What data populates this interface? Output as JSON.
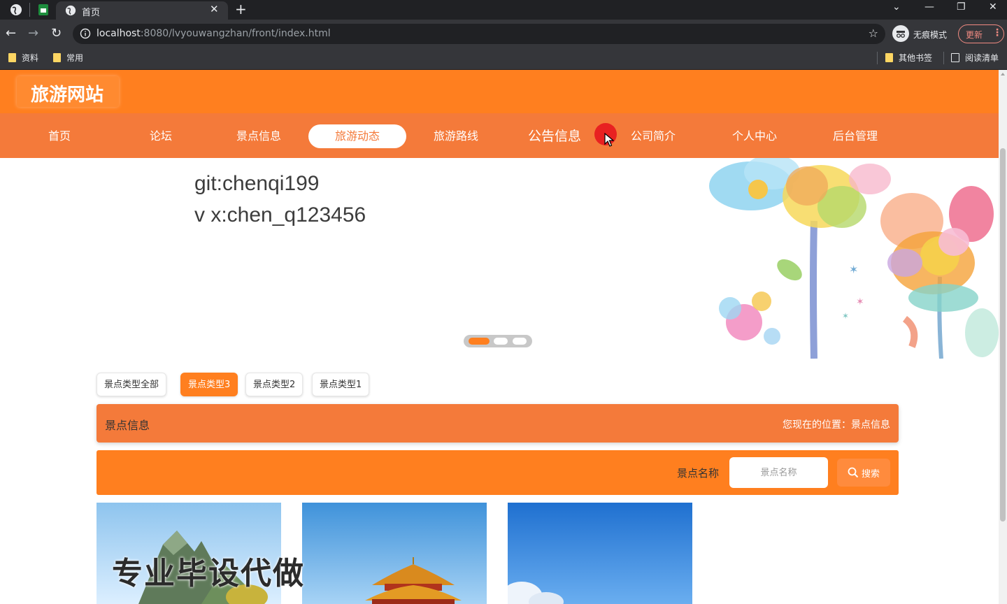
{
  "browser": {
    "tab_title": "首页",
    "url_host": "localhost",
    "url_rest": ":8080/lvyouwangzhan/front/index.html",
    "incognito_label": "无痕模式",
    "update_label": "更新",
    "bookmarks": [
      "资料",
      "常用"
    ],
    "other_bookmarks": "其他书签",
    "reading_list": "阅读清单"
  },
  "site": {
    "logo": "旅游网站",
    "nav": [
      "首页",
      "论坛",
      "景点信息",
      "旅游动态",
      "旅游路线",
      "公告信息",
      "公司简介",
      "个人中心",
      "后台管理"
    ],
    "active_nav": "旅游动态"
  },
  "banner": {
    "line1": "git:chenqi199",
    "line2": "v x:chen_q123456",
    "carousel_active_index": 0,
    "carousel_count": 3
  },
  "filters": {
    "items": [
      "景点类型全部",
      "景点类型3",
      "景点类型2",
      "景点类型1"
    ],
    "active": "景点类型3"
  },
  "section": {
    "title": "景点信息",
    "breadcrumb": "您现在的位置：景点信息"
  },
  "search": {
    "label": "景点名称",
    "placeholder": "景点名称",
    "button": "搜索"
  },
  "watermark": "专业毕设代做",
  "colors": {
    "primary": "#ff7f1f",
    "nav": "#f47a3a"
  }
}
